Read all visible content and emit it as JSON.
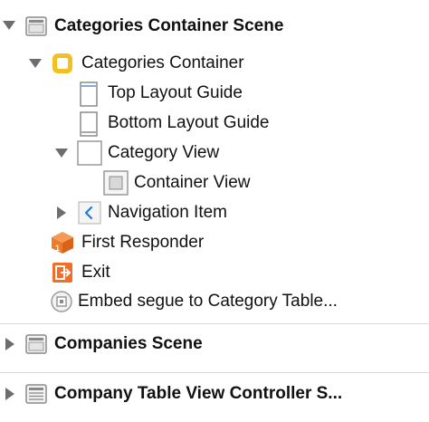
{
  "outline": {
    "scene1": {
      "title": "Categories Container Scene",
      "container": {
        "title": "Categories Container",
        "top_layout": "Top Layout Guide",
        "bottom_layout": "Bottom Layout Guide",
        "category_view": {
          "title": "Category View",
          "container_view": "Container View"
        },
        "navigation_item": "Navigation Item"
      },
      "first_responder": "First Responder",
      "exit": "Exit",
      "segue": "Embed segue to Category Table..."
    },
    "scene2": {
      "title": "Companies Scene"
    },
    "scene3": {
      "title": "Company Table View Controller S..."
    }
  },
  "colors": {
    "disclosure": "#6d6d6d",
    "icon_gray": "#8a8a8a",
    "controller_yellow": "#f4c020",
    "nav_blue": "#1f7be0",
    "responder_orange": "#ee7a2c",
    "exit_orange": "#ee6e2a",
    "separator": "#dadada"
  }
}
